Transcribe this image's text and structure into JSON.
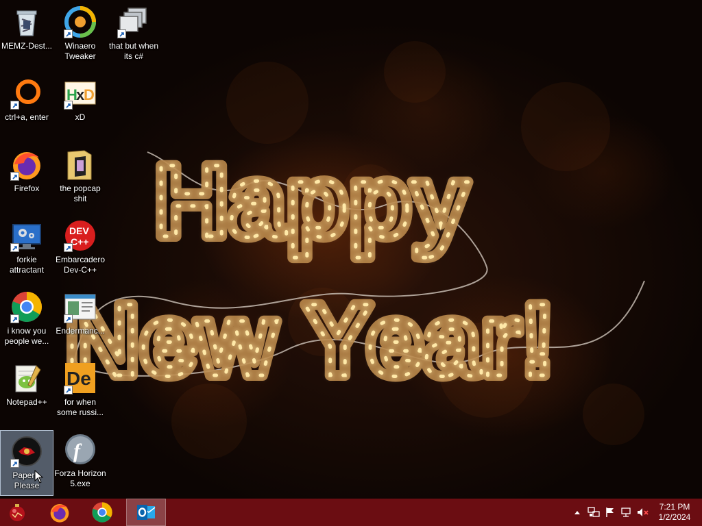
{
  "wallpaper": {
    "line1": "Happy",
    "line2": "New Year!",
    "glow_color": "#f7d98a",
    "tube_color": "#8a5a20"
  },
  "desktop_icons": [
    {
      "label": "MEMZ-Dest...",
      "icon": "recycle-bin-icon"
    },
    {
      "label": "Winaero Tweaker",
      "icon": "winaero-tweaker-icon"
    },
    {
      "label": "that but when its c#",
      "icon": "stacked-windows-icon"
    },
    {
      "label": "ctrl+a, enter",
      "icon": "orange-ring-icon"
    },
    {
      "label": "xD",
      "icon": "hxd-icon"
    },
    {
      "label": "Firefox",
      "icon": "firefox-icon"
    },
    {
      "label": "the popcap shit",
      "icon": "folder-icon"
    },
    {
      "label": "forkie attractant",
      "icon": "settings-monitor-icon"
    },
    {
      "label": "Embarcadero Dev-C++",
      "icon": "dev-cpp-icon"
    },
    {
      "label": "i know you people we...",
      "icon": "chrome-icon"
    },
    {
      "label": "Endermanc...",
      "icon": "window-app-icon"
    },
    {
      "label": "Notepad++",
      "icon": "notepad-plus-plus-icon"
    },
    {
      "label": "for when some russi...",
      "icon": "de-icon"
    },
    {
      "label": "Papers, Please",
      "icon": "papers-please-icon",
      "selected": true
    },
    {
      "label": "Forza Horizon 5.exe",
      "icon": "flash-player-icon"
    }
  ],
  "taskbar": {
    "color": "#6b0d12",
    "buttons": [
      {
        "name": "start",
        "icon": "start-ornament-icon"
      },
      {
        "name": "firefox",
        "icon": "firefox-icon"
      },
      {
        "name": "chrome",
        "icon": "chrome-icon"
      },
      {
        "name": "outlook",
        "icon": "outlook-icon",
        "active": true
      }
    ],
    "tray": {
      "icons": [
        "chevron-up-icon",
        "network-share-icon",
        "flag-icon",
        "network-icon",
        "volume-muted-icon"
      ],
      "time": "7:21 PM",
      "date": "1/2/2024"
    }
  }
}
